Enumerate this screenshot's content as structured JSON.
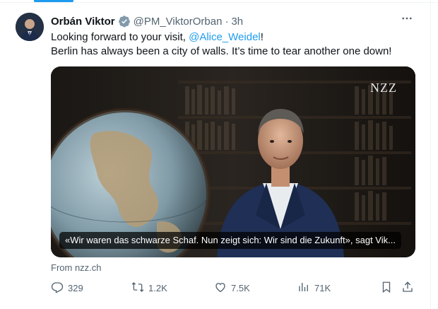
{
  "author": {
    "name": "Orbán Viktor",
    "handle": "@PM_ViktorOrban",
    "separator": "·",
    "time": "3h"
  },
  "tweet": {
    "text_before": "Looking forward to your visit, ",
    "mention": "@Alice_Weidel",
    "text_after": "!",
    "line2": "Berlin has always been a city of walls. It’s time to tear another one down!"
  },
  "card": {
    "watermark": "NZZ",
    "caption": "«Wir waren das schwarze Schaf. Nun zeigt sich: Wir sind die Zukunft», sagt Vik...",
    "source": "From nzz.ch"
  },
  "actions": {
    "replies": "329",
    "reposts": "1.2K",
    "likes": "7.5K",
    "views": "71K"
  },
  "icons": {
    "more": "more-icon",
    "verified": "verified-badge-icon",
    "reply": "reply-icon",
    "repost": "repost-icon",
    "like": "heart-icon",
    "views": "views-icon",
    "bookmark": "bookmark-icon",
    "share": "share-icon"
  },
  "colors": {
    "accent": "#1d9bf0",
    "text": "#0f1419",
    "secondary": "#536471",
    "verified": "#829aab"
  }
}
